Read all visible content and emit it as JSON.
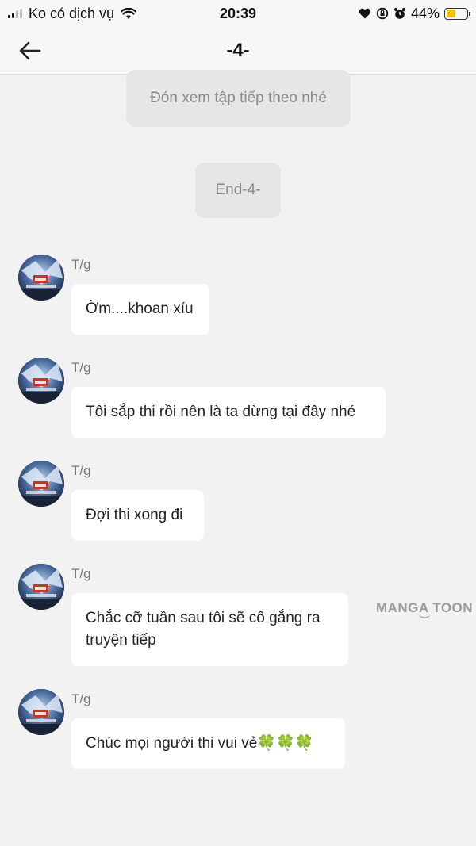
{
  "status_bar": {
    "carrier": "Ko có dịch vụ",
    "time": "20:39",
    "battery": "44%",
    "battery_level": 0.44,
    "icons": [
      "signal-icon",
      "wifi-icon",
      "heart-icon",
      "orientation-lock-icon",
      "alarm-icon",
      "battery-icon"
    ]
  },
  "header": {
    "title": "-4-",
    "back_icon": "back-arrow-icon"
  },
  "narrations": [
    {
      "text": "Đón xem tập tiếp theo nhé"
    },
    {
      "text": "End-4-"
    }
  ],
  "messages": [
    {
      "sender": "T/g",
      "text": "Ờm....khoan xíu"
    },
    {
      "sender": "T/g",
      "text": "Tôi sắp thi rồi nên là ta dừng tại đây nhé"
    },
    {
      "sender": "T/g",
      "text": "Đợi thi xong đi"
    },
    {
      "sender": "T/g",
      "text": "Chắc cỡ tuần sau tôi sẽ cố gắng ra truyện tiếp"
    },
    {
      "sender": "T/g",
      "text": "Chúc mọi người thi vui vẻ🍀🍀🍀"
    }
  ],
  "watermark": "MANGA TOON",
  "colors": {
    "background": "#f2f2f2",
    "bubble": "#ffffff",
    "narration_bg": "#e6e6e6",
    "battery": "#f5c400"
  }
}
